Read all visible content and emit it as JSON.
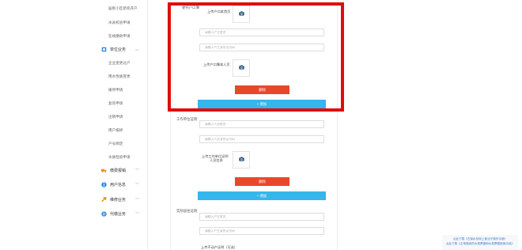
{
  "sidebar": {
    "top_items": [
      "居民小区新装开户",
      "水表校验申请",
      "在线缴款申请"
    ],
    "unit_group": "单位业务",
    "unit_items": [
      "企业变更过户",
      "用水性质变更",
      "报停申请",
      "复装申请",
      "注销申请",
      "用户报修",
      "户号绑定",
      "水质检验申请"
    ],
    "groups": [
      {
        "label": "缴费报销",
        "icon": "truck-icon",
        "color": "#f08a1c"
      },
      {
        "label": "用户信息",
        "icon": "info-icon",
        "color": "#2f88e0"
      },
      {
        "label": "维修业务",
        "icon": "tools-icon",
        "color": "#f08a1c"
      },
      {
        "label": "代缴业务",
        "icon": "coin-icon",
        "color": "#2f88e0"
      }
    ]
  },
  "form": {
    "section1_label": "委托户口簿",
    "upload1_label": "上传户口本首页",
    "name_placeholder": "请输入户主姓名",
    "idcard_placeholder": "请输入户主身份证号码",
    "upload2_label": "上传户口簿本人页",
    "delete_label": "删除",
    "add_label": "+ 增加",
    "section2_label": "工作单位证明",
    "person_name_placeholder": "请输入人员姓名",
    "person_id_placeholder": "请输入人员身份证号码",
    "upload3_label_line1": "上传工作单位证明",
    "upload3_label_line2": "人员信息",
    "section3_label": "实际居住证明",
    "resident_name_placeholder": "请输入户主姓名",
    "resident_id_placeholder": "请输入户主身份证号码",
    "upload4_label": "上传不动产证明（可选）"
  },
  "footer": {
    "link1": "点此下载《古镇水务网上营业厅操作手册》",
    "link2": "点此下载《正常缴纳的水费票据和水费票据报销手续》"
  },
  "colors": {
    "danger": "#e8482a",
    "primary": "#35b6ec",
    "highlight": "#e00d0d"
  }
}
